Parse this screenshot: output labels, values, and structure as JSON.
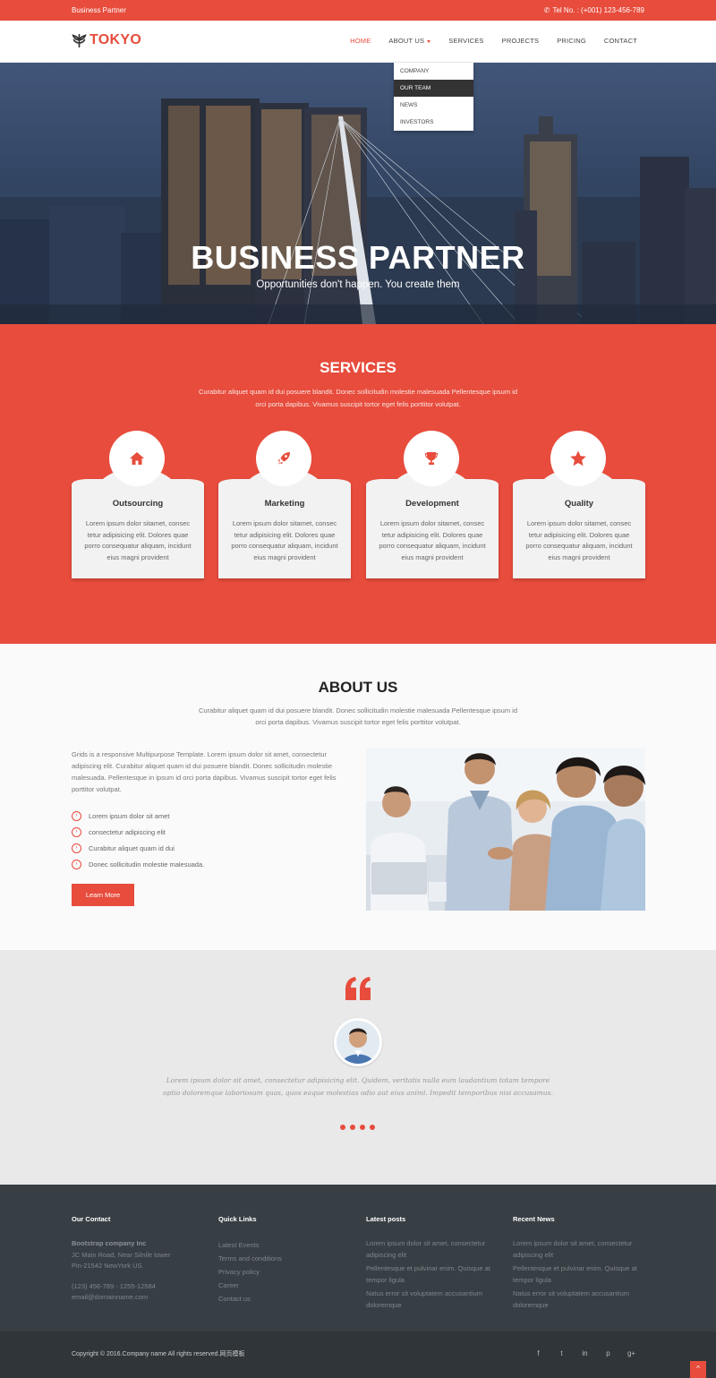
{
  "topbar": {
    "brand": "Business Partner",
    "tel_label": "Tel No. :",
    "tel_number": "(+001) 123-456-789"
  },
  "logo": {
    "text": "TOKYO"
  },
  "nav": {
    "items": [
      {
        "label": "HOME"
      },
      {
        "label": "ABOUT US"
      },
      {
        "label": "SERVICES"
      },
      {
        "label": "PROJECTS"
      },
      {
        "label": "PRICING"
      },
      {
        "label": "CONTACT"
      }
    ],
    "dropdown": [
      {
        "label": "COMPANY"
      },
      {
        "label": "OUR TEAM"
      },
      {
        "label": "NEWS"
      },
      {
        "label": "INVESTORS"
      }
    ]
  },
  "hero": {
    "title": "BUSINESS PARTNER",
    "subtitle": "Opportunities don't happen. You create them"
  },
  "services": {
    "title": "SERVICES",
    "intro": "Curabitur aliquet quam id dui posuere blandit. Donec sollicitudin molestie malesuada Pellentesque ipsum id orci porta dapibus. Vivamus suscipit tortor eget felis porttitor volutpat.",
    "cards": [
      {
        "icon": "home-icon",
        "title": "Outsourcing",
        "text": "Lorem ipsum dolor sitamet, consec tetur adipisicing elit. Dolores quae porro consequatur aliquam, incidunt eius magni provident"
      },
      {
        "icon": "rocket-icon",
        "title": "Marketing",
        "text": "Lorem ipsum dolor sitamet, consec tetur adipisicing elit. Dolores quae porro consequatur aliquam, incidunt eius magni provident"
      },
      {
        "icon": "trophy-icon",
        "title": "Development",
        "text": "Lorem ipsum dolor sitamet, consec tetur adipisicing elit. Dolores quae porro consequatur aliquam, incidunt eius magni provident"
      },
      {
        "icon": "star-icon",
        "title": "Quality",
        "text": "Lorem ipsum dolor sitamet, consec tetur adipisicing elit. Dolores quae porro consequatur aliquam, incidunt eius magni provident"
      }
    ]
  },
  "about": {
    "title": "ABOUT US",
    "intro": "Curabitur aliquet quam id dui posuere blandit. Donec sollicitudin molestie malesuada Pellentesque ipsum id orci porta dapibus. Vivamus suscipit tortor eget felis porttitor volutpat.",
    "paragraph": "Grids is a responsive Multipurpose Template. Lorem ipsum dolor sit amet, consectetur adipiscing elit. Curabitur aliquet quam id dui posuere blandit. Donec sollicitudin molestie malesuada. Pellentesque in ipsum id orci porta dapibus. Vivamus suscipit tortor eget felis porttitor volutpat.",
    "list": [
      "Lorem ipsum dolor sit amet",
      "consectetur adipiscing elit",
      "Curabitur aliquet quam id dui",
      "Donec sollicitudin molestie malesuada."
    ],
    "button": "Learn More"
  },
  "testimonial": {
    "quote": "Lorem ipsum dolor sit amet, consectetur adipisicing elit. Quidem, veritatis nulla eum laudantium totam tempore optio doloremque laboriosam quas, quos eaque molestias odio aut eius animi. Impedit temporibus nisi accusamus."
  },
  "footer": {
    "contact": {
      "title": "Our Contact",
      "company": "Bootstrap company Inc",
      "address1": "JC Main Road, Near Silnile tower",
      "address2": "Pin-21542 NewYork US.",
      "phone": "(123) 456-789 - 1255-12584",
      "email": "email@domainname.com"
    },
    "quick_links": {
      "title": "Quick Links",
      "items": [
        "Latest Events",
        "Terms and conditions",
        "Privacy policy",
        "Career",
        "Contact us"
      ]
    },
    "latest_posts": {
      "title": "Latest posts",
      "items": [
        "Lorem ipsum dolor sit amet, consectetur adipiscing elit",
        "Pellentesque et pulvinar enim. Quisque at tempor ligula",
        "Natus error sit voluptatem accusantium doloremque"
      ]
    },
    "recent_news": {
      "title": "Recent News",
      "items": [
        "Lorem ipsum dolor sit amet, consectetur adipiscing elit",
        "Pellentesque et pulvinar enim. Quisque at tempor ligula",
        "Natus error sit voluptatem accusantium doloremque"
      ]
    },
    "copyright": "Copyright © 2016.Company name All rights reserved.网页模板",
    "social": [
      {
        "icon": "facebook-icon",
        "glyph": "f"
      },
      {
        "icon": "twitter-icon",
        "glyph": "t"
      },
      {
        "icon": "linkedin-icon",
        "glyph": "in"
      },
      {
        "icon": "pinterest-icon",
        "glyph": "p"
      },
      {
        "icon": "google-plus-icon",
        "glyph": "g+"
      }
    ],
    "to_top_glyph": "^"
  },
  "colors": {
    "accent": "#e74c3c",
    "footer": "#383f44",
    "footer_bottom": "#2f3539"
  }
}
